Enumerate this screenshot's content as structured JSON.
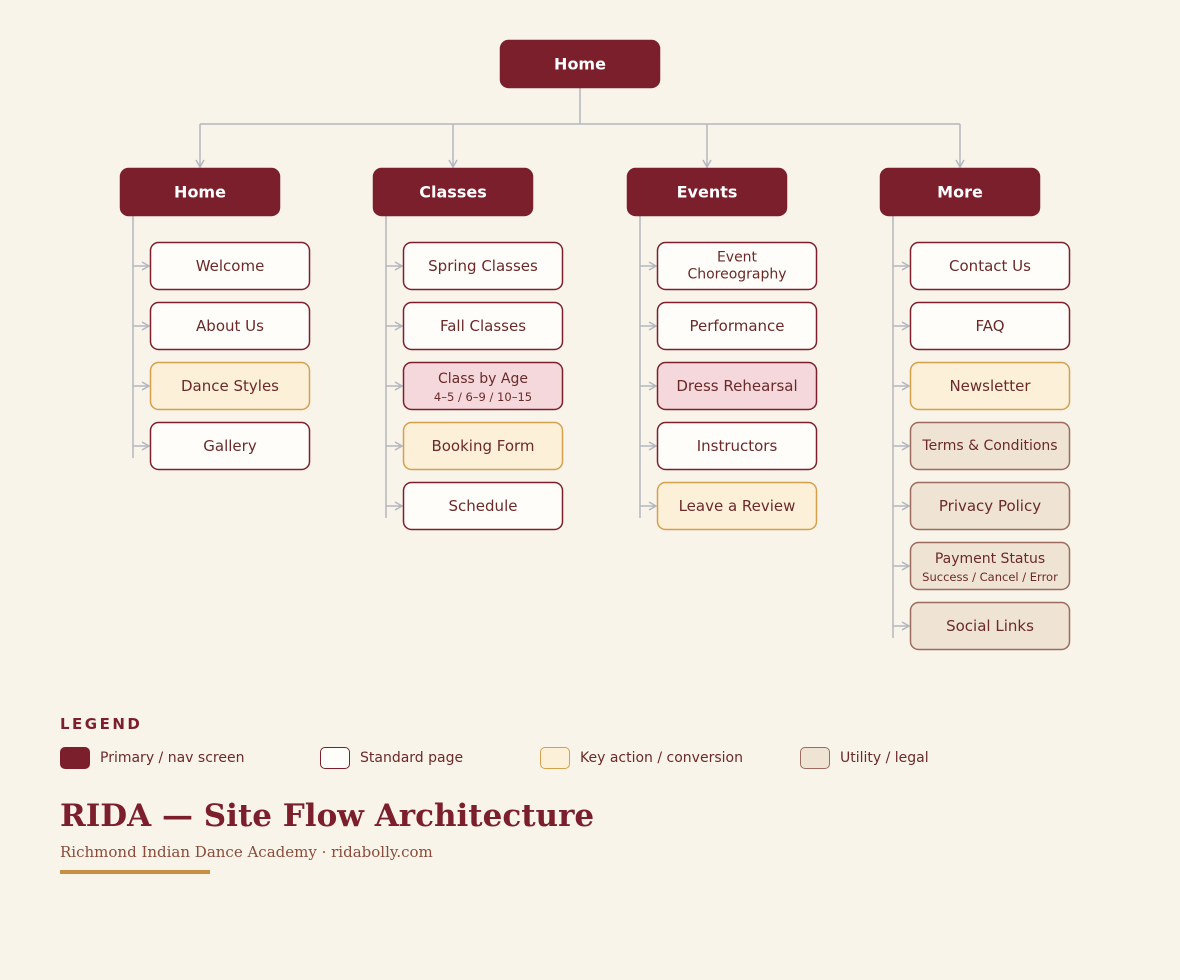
{
  "colors": {
    "background": "#f9f4ea",
    "primary_fill": "#7b1f2c",
    "primary_text": "#ffffff",
    "standard_fill": "#fffdf9",
    "standard_border": "#7b1f2c",
    "key_fill": "#fdf0d8",
    "key_border": "#d4a04c",
    "alt_fill": "#f4d8dc",
    "alt_border": "#7b1f2c",
    "utility_fill": "#efe4d3",
    "utility_border": "#9c6b5e",
    "node_text": "#6b2a2a",
    "connector": "#b3b7bf"
  },
  "root": {
    "label": "Home",
    "type": "primary"
  },
  "sections": [
    {
      "label": "Home",
      "type": "primary",
      "children": [
        {
          "label": "Welcome",
          "type": "standard"
        },
        {
          "label": "About Us",
          "type": "standard"
        },
        {
          "label": "Dance Styles",
          "type": "key"
        },
        {
          "label": "Gallery",
          "type": "standard"
        }
      ]
    },
    {
      "label": "Classes",
      "type": "primary",
      "children": [
        {
          "label": "Spring Classes",
          "type": "standard"
        },
        {
          "label": "Fall Classes",
          "type": "standard"
        },
        {
          "label": "Class by Age",
          "sublabel": "4–5 / 6–9 / 10–15",
          "type": "alt"
        },
        {
          "label": "Booking Form",
          "type": "key"
        },
        {
          "label": "Schedule",
          "type": "standard"
        }
      ]
    },
    {
      "label": "Events",
      "type": "primary",
      "children": [
        {
          "label": "Event Choreography",
          "lines": [
            "Event",
            "Choreography"
          ],
          "type": "standard"
        },
        {
          "label": "Performance",
          "type": "standard"
        },
        {
          "label": "Dress Rehearsal",
          "type": "alt"
        },
        {
          "label": "Instructors",
          "type": "standard"
        },
        {
          "label": "Leave a Review",
          "type": "key"
        }
      ]
    },
    {
      "label": "More",
      "type": "primary",
      "children": [
        {
          "label": "Contact Us",
          "type": "standard"
        },
        {
          "label": "FAQ",
          "type": "standard"
        },
        {
          "label": "Newsletter",
          "type": "key"
        },
        {
          "label": "Terms & Conditions",
          "type": "utility"
        },
        {
          "label": "Privacy Policy",
          "type": "utility"
        },
        {
          "label": "Payment Status",
          "sublabel": "Success / Cancel / Error",
          "type": "utility"
        },
        {
          "label": "Social Links",
          "type": "utility"
        }
      ]
    }
  ],
  "legend": {
    "title": "LEGEND",
    "items": [
      {
        "label": "Primary / nav screen",
        "type": "primary"
      },
      {
        "label": "Standard page",
        "type": "standard"
      },
      {
        "label": "Key action / conversion",
        "type": "key"
      },
      {
        "label": "Utility / legal",
        "type": "utility"
      }
    ]
  },
  "footer": {
    "title": "RIDA — Site Flow Architecture",
    "subtitle": "Richmond Indian Dance Academy · ridabolly.com"
  }
}
